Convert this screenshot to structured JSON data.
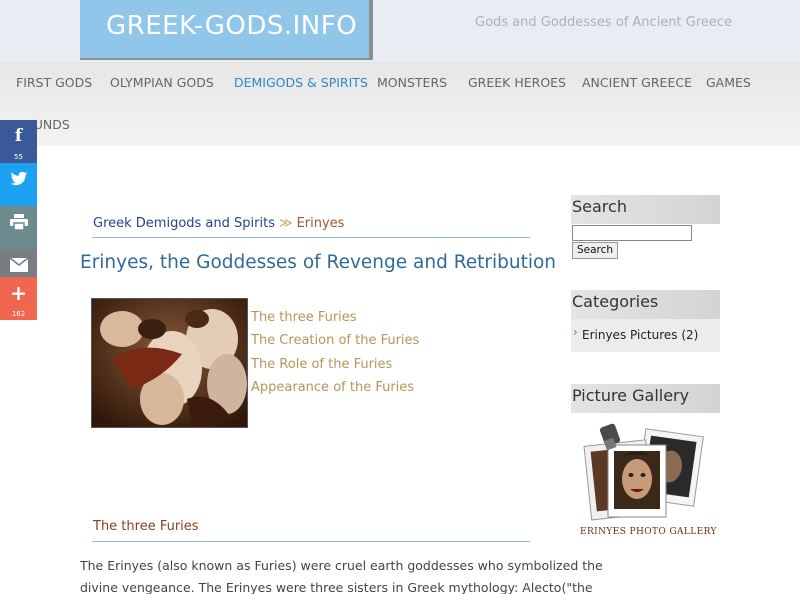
{
  "site": {
    "logo": "GREEK-GODS.INFO",
    "tagline": "Gods and Goddesses of Ancient Greece"
  },
  "nav": {
    "items": [
      {
        "label": "FIRST GODS"
      },
      {
        "label": "OLYMPIAN GODS"
      },
      {
        "label": "DEMIGODS & SPIRITS"
      },
      {
        "label": "MONSTERS"
      },
      {
        "label": "GREEK HEROES"
      },
      {
        "label": "ANCIENT GREECE"
      },
      {
        "label": "GAMES"
      },
      {
        "label": "SOUNDS"
      }
    ],
    "active_label": "DEMIGODS & SPIRITS"
  },
  "share": {
    "facebook_count": "55",
    "more_count": "162",
    "colors": {
      "facebook": "#3b5998",
      "twitter": "#1da1f2",
      "print": "#6d8a8f",
      "email": "#777d81",
      "more": "#f0664e"
    }
  },
  "breadcrumb": {
    "parent": "Greek Demigods and Spirits",
    "separator": "≫",
    "current": "Erinyes"
  },
  "article": {
    "title": "Erinyes, the Goddesses of Revenge and Retribution",
    "toc": [
      "The three Furies",
      "The Creation of the Furies",
      "The Role of the Furies",
      "Appearance of the Furies"
    ],
    "section_title": "The three Furies",
    "paragraph_lines": [
      "The Erinyes (also known as Furies) were cruel earth goddesses who symbolized the",
      "divine vengeance. The Erinyes were three sisters in Greek mythology: Alecto(\"the"
    ]
  },
  "sidebar": {
    "search_title": "Search",
    "search_button": "Search",
    "search_value": "",
    "categories_title": "Categories",
    "category_item": "Erinyes Pictures (2)",
    "gallery_title": "Picture Gallery",
    "gallery_caption": "ERINYES PHOTO GALLERY"
  },
  "colors": {
    "logo_bg": "#8fc6ea",
    "nav_active": "#2f89c8",
    "title": "#2f6a99",
    "toc_link": "#b29758"
  }
}
